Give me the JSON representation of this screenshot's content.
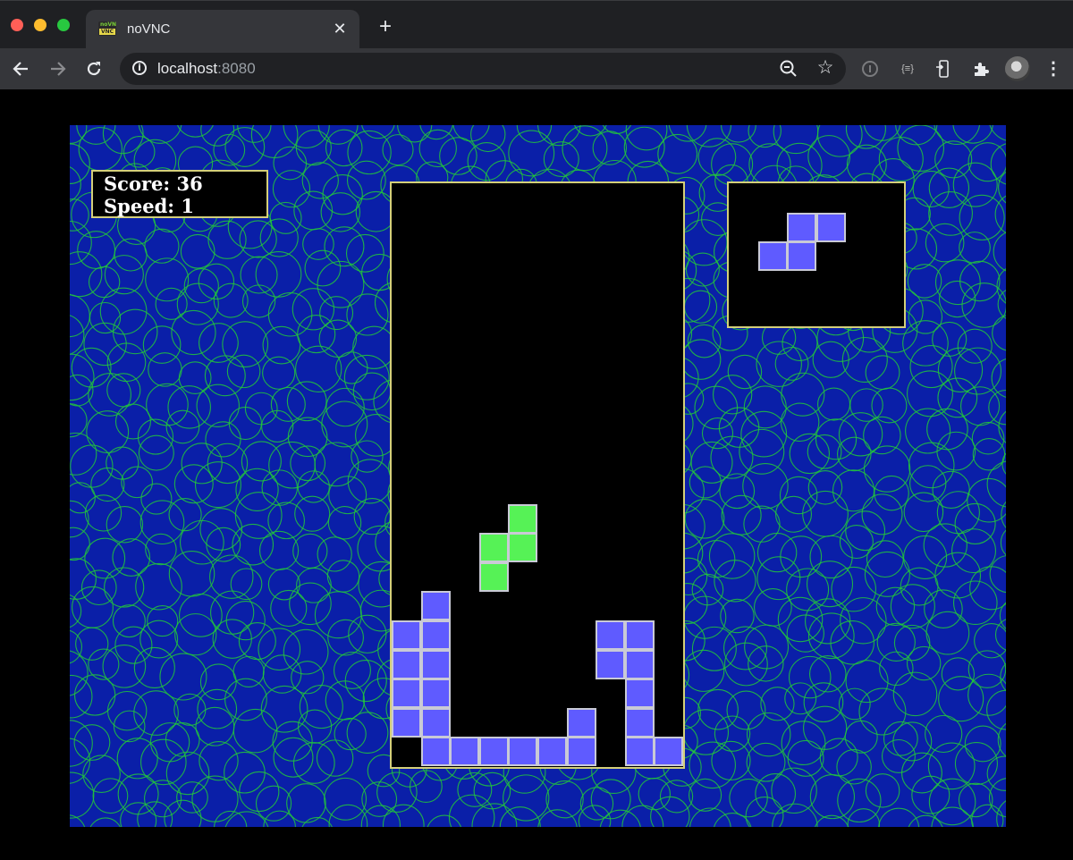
{
  "browser": {
    "tab": {
      "title": "noVNC",
      "favicon_top": "noVNC",
      "favicon_bottom": "VNC",
      "close_icon": "close-icon"
    },
    "new_tab_icon": "plus-icon",
    "toolbar": {
      "back_icon": "arrow-left-icon",
      "forward_icon": "arrow-right-icon",
      "reload_icon": "reload-icon",
      "url_host": "localhost",
      "url_port": ":8080",
      "zoom_icon": "zoom-out-icon",
      "bookmark_icon": "star-icon",
      "extensions": [
        "info-extension-icon",
        "json-extension-icon",
        "device-extension-icon",
        "puzzle-extensions-icon"
      ],
      "menu_icon": "kebab-menu-icon"
    }
  },
  "game": {
    "score_label": "Score:",
    "score_value": "36",
    "speed_label": "Speed:",
    "speed_value": "1",
    "colors": {
      "background": "#0a1fa8",
      "pattern": "#22c83a",
      "frame": "#d4cf7a",
      "purple_block": "#5f5bff",
      "green_block": "#56f256"
    },
    "board": {
      "columns": 10,
      "rows": 20,
      "falling_piece": {
        "color": "green",
        "cells": [
          [
            4,
            11
          ],
          [
            3,
            12
          ],
          [
            4,
            12
          ],
          [
            3,
            13
          ]
        ]
      },
      "stack": {
        "color": "purple",
        "cells": [
          [
            1,
            14
          ],
          [
            0,
            15
          ],
          [
            1,
            15
          ],
          [
            7,
            15
          ],
          [
            8,
            15
          ],
          [
            0,
            16
          ],
          [
            1,
            16
          ],
          [
            7,
            16
          ],
          [
            8,
            16
          ],
          [
            0,
            17
          ],
          [
            1,
            17
          ],
          [
            8,
            17
          ],
          [
            0,
            18
          ],
          [
            1,
            18
          ],
          [
            6,
            18
          ],
          [
            8,
            18
          ],
          [
            1,
            19
          ],
          [
            2,
            19
          ],
          [
            3,
            19
          ],
          [
            4,
            19
          ],
          [
            5,
            19
          ],
          [
            6,
            19
          ],
          [
            8,
            19
          ],
          [
            9,
            19
          ]
        ]
      }
    },
    "next_piece": {
      "color": "purple",
      "cells": [
        [
          2,
          1
        ],
        [
          3,
          1
        ],
        [
          1,
          2
        ],
        [
          2,
          2
        ]
      ]
    }
  }
}
